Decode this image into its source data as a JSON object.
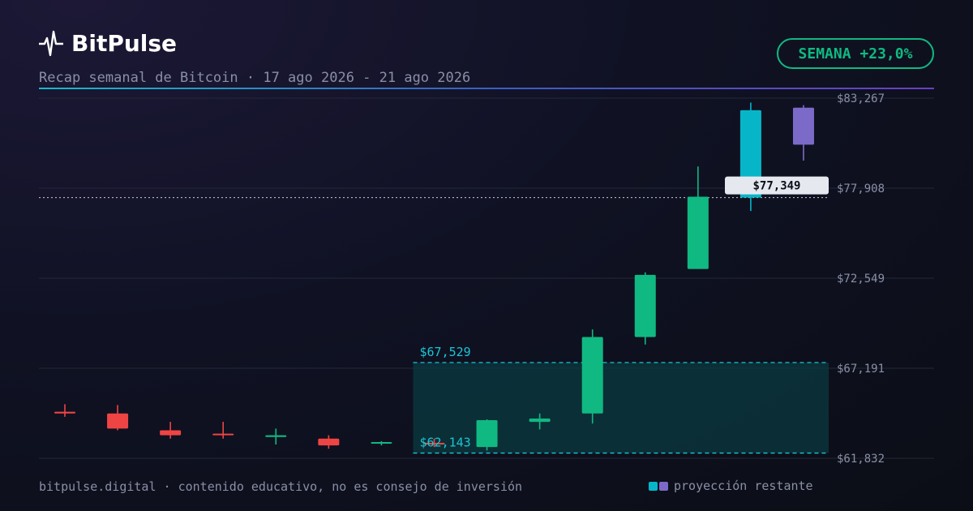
{
  "header": {
    "brand": "BitPulse",
    "subtitle": "Recap semanal de Bitcoin · 17 ago 2026 - 21 ago 2026",
    "week_badge": "SEMANA +23,0%"
  },
  "footer": {
    "note": "bitpulse.digital · contenido educativo, no es consejo de inversión",
    "legend_label": "proyección restante"
  },
  "colors": {
    "up": "#10b981",
    "down": "#ef4444",
    "projection_1": "#06b6c8",
    "projection_2": "#7c6ac9",
    "range_line": "#19c6d6",
    "grid": "#232838",
    "axis_text": "#8a8fa6"
  },
  "chart_data": {
    "type": "candlestick",
    "ylim": [
      61832,
      83267
    ],
    "y_ticks": [
      "$83,267",
      "$77,908",
      "$72,549",
      "$67,191",
      "$61,832"
    ],
    "y_tick_values": [
      83267,
      77908,
      72549,
      67191,
      61832
    ],
    "candles": [
      {
        "open": 64500,
        "high": 65050,
        "low": 64300,
        "close": 64600,
        "kind": "down"
      },
      {
        "open": 64500,
        "high": 65000,
        "low": 63500,
        "close": 63600,
        "kind": "down"
      },
      {
        "open": 63500,
        "high": 64000,
        "low": 63000,
        "close": 63200,
        "kind": "down"
      },
      {
        "open": 63300,
        "high": 64000,
        "low": 63000,
        "close": 63200,
        "kind": "down"
      },
      {
        "open": 63100,
        "high": 63600,
        "low": 62650,
        "close": 63200,
        "kind": "up"
      },
      {
        "open": 63000,
        "high": 63200,
        "low": 62400,
        "close": 62600,
        "kind": "down"
      },
      {
        "open": 62700,
        "high": 62850,
        "low": 62600,
        "close": 62800,
        "kind": "up"
      },
      {
        "open": 62750,
        "high": 63000,
        "low": 62500,
        "close": 62650,
        "kind": "down"
      },
      {
        "open": 62500,
        "high": 64150,
        "low": 62300,
        "close": 64100,
        "kind": "up"
      },
      {
        "open": 64000,
        "high": 64500,
        "low": 63550,
        "close": 64200,
        "kind": "up"
      },
      {
        "open": 64500,
        "high": 69500,
        "low": 63900,
        "close": 69050,
        "kind": "up"
      },
      {
        "open": 69050,
        "high": 72900,
        "low": 68600,
        "close": 72750,
        "kind": "up"
      },
      {
        "open": 73100,
        "high": 79200,
        "low": 73100,
        "close": 77400,
        "kind": "up"
      },
      {
        "open": 77349,
        "high": 83000,
        "low": 76550,
        "close": 82550,
        "kind": "projection_1"
      },
      {
        "open": 80500,
        "high": 82850,
        "low": 79550,
        "close": 82700,
        "kind": "projection_2"
      }
    ],
    "range": {
      "high": 67529,
      "low": 62143,
      "high_label": "$67,529",
      "low_label": "$62,143",
      "start_index": 7
    },
    "current_price": {
      "value": 77349,
      "label": "$77,349"
    }
  }
}
